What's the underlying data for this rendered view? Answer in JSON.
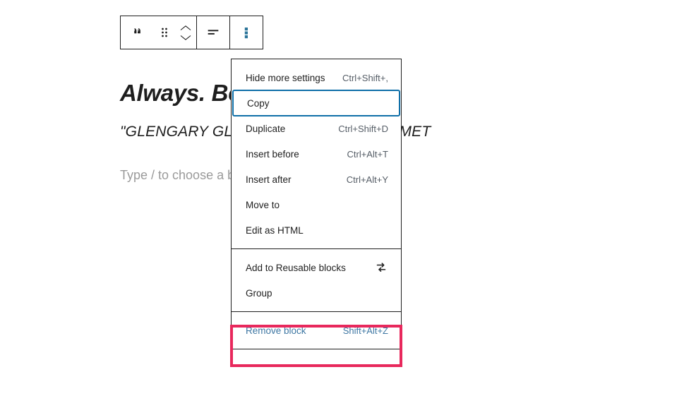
{
  "editor": {
    "post_title": "page",
    "heading_block_text": "Always. Be",
    "quote_block_text": "\"GLENGARY GL",
    "quote_block_text_tail": "AMET",
    "paragraph_placeholder": "Type / to choose a b"
  },
  "toolbar": {
    "aria_label": "Block tools",
    "buttons": [
      {
        "name": "block-type-quote",
        "icon": "quote-icon",
        "label": "Quote"
      },
      {
        "name": "drag-handle",
        "icon": "drag-handle-icon",
        "label": "Drag"
      },
      {
        "name": "block-mover",
        "icon": "chevron-up-down-icon",
        "label": "Move up or down"
      },
      {
        "name": "align-text",
        "icon": "align-left-icon",
        "label": "Change text alignment"
      },
      {
        "name": "more-options",
        "icon": "three-dots-vertical-icon",
        "label": "Options"
      }
    ]
  },
  "menu": {
    "aria_label": "Options",
    "sections": [
      {
        "name": "settings-and-clipboard",
        "items": [
          {
            "label": "Hide more settings",
            "shortcut": "Ctrl+Shift+,",
            "name": "menu-item-hide-more-settings",
            "focused": false,
            "danger": false,
            "icon": ""
          },
          {
            "label": "Copy",
            "shortcut": "",
            "name": "menu-item-copy",
            "focused": true,
            "danger": false,
            "icon": ""
          },
          {
            "label": "Duplicate",
            "shortcut": "Ctrl+Shift+D",
            "name": "menu-item-duplicate",
            "focused": false,
            "danger": false,
            "icon": ""
          },
          {
            "label": "Insert before",
            "shortcut": "Ctrl+Alt+T",
            "name": "menu-item-insert-before",
            "focused": false,
            "danger": false,
            "icon": ""
          },
          {
            "label": "Insert after",
            "shortcut": "Ctrl+Alt+Y",
            "name": "menu-item-insert-after",
            "focused": false,
            "danger": false,
            "icon": ""
          },
          {
            "label": "Move to",
            "shortcut": "",
            "name": "menu-item-move-to",
            "focused": false,
            "danger": false,
            "icon": ""
          },
          {
            "label": "Edit as HTML",
            "shortcut": "",
            "name": "menu-item-edit-as-html",
            "focused": false,
            "danger": false,
            "icon": ""
          }
        ]
      },
      {
        "name": "block-transforms",
        "items": [
          {
            "label": "Add to Reusable blocks",
            "shortcut": "",
            "name": "menu-item-add-to-reusable-blocks",
            "focused": false,
            "danger": false,
            "icon": "reusable-block-icon"
          },
          {
            "label": "Group",
            "shortcut": "",
            "name": "menu-item-group",
            "focused": false,
            "danger": false,
            "icon": ""
          }
        ]
      },
      {
        "name": "destructive-actions",
        "items": [
          {
            "label": "Remove block",
            "shortcut": "Shift+Alt+Z",
            "name": "menu-item-remove-block",
            "focused": false,
            "danger": true,
            "icon": ""
          }
        ]
      }
    ]
  },
  "annotation": {
    "name": "highlight-remove-block",
    "color": "#e8285c"
  },
  "colors": {
    "accent_blue": "#0f6fa8",
    "icon_active_blue": "#2b7499",
    "link_blue": "#3e77a3",
    "text": "#1e1e1e",
    "muted_text": "#555d66",
    "placeholder": "#9a9a9a",
    "annotation_pink": "#e8285c"
  }
}
